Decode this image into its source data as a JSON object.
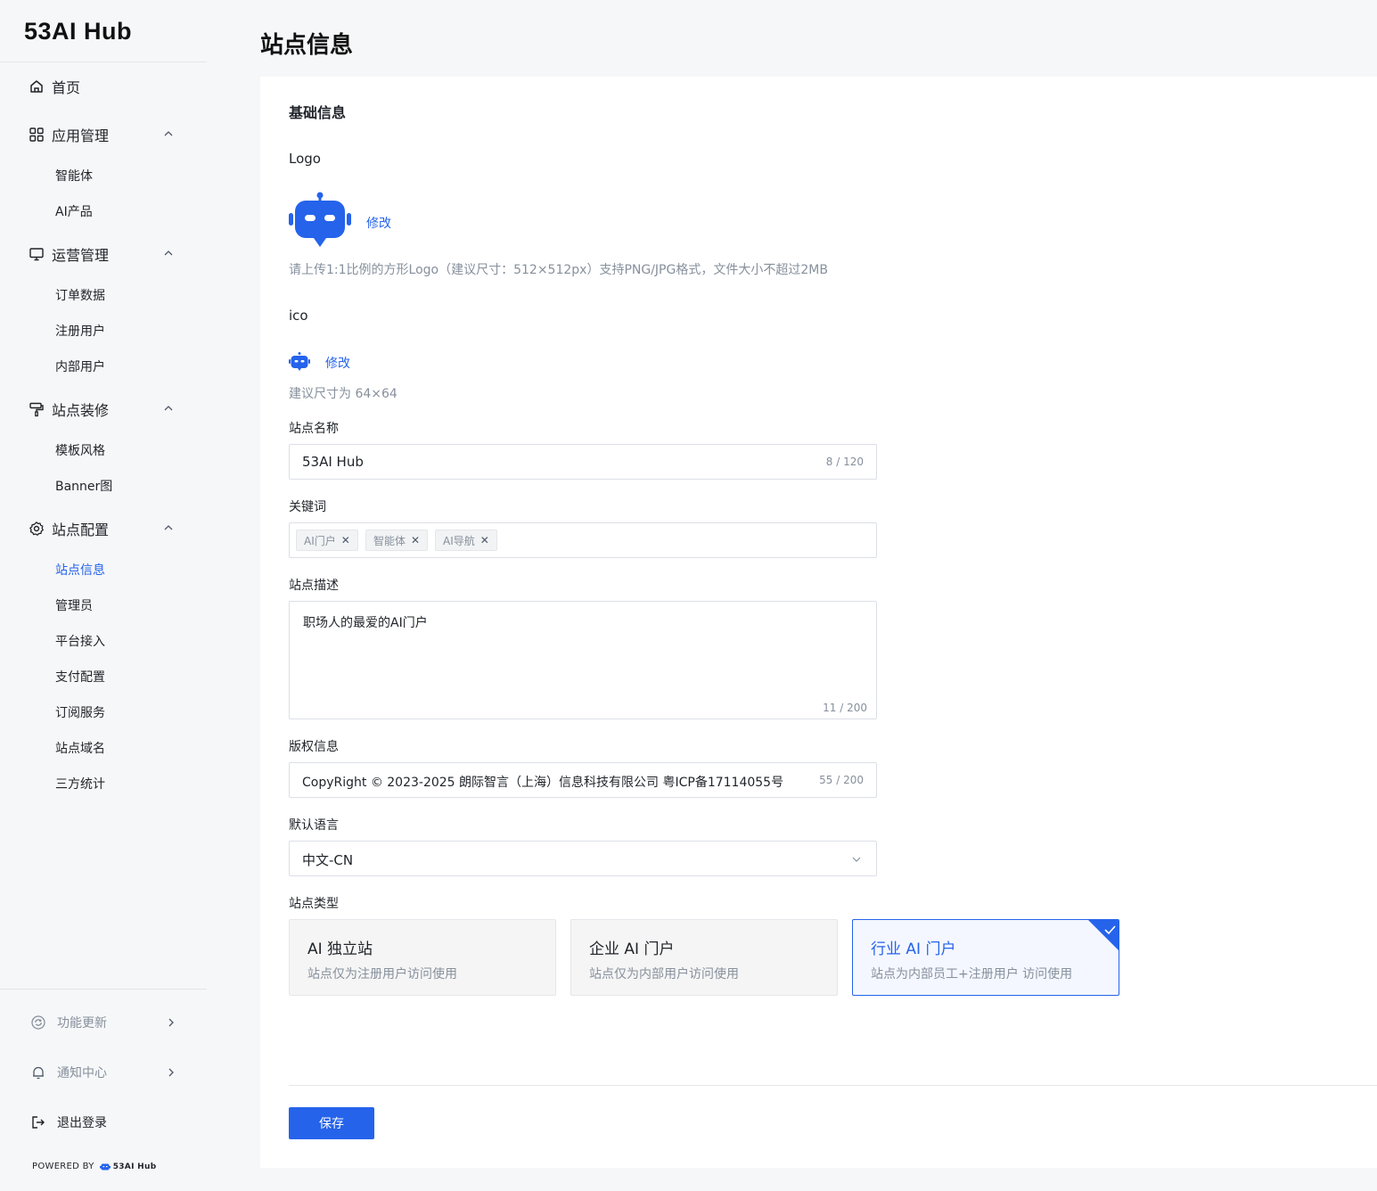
{
  "brand": "53AI Hub",
  "sidebar": {
    "home": "首页",
    "groups": [
      {
        "label": "应用管理",
        "items": [
          "智能体",
          "AI产品"
        ]
      },
      {
        "label": "运营管理",
        "items": [
          "订单数据",
          "注册用户",
          "内部用户"
        ]
      },
      {
        "label": "站点装修",
        "items": [
          "模板风格",
          "Banner图"
        ]
      },
      {
        "label": "站点配置",
        "items": [
          "站点信息",
          "管理员",
          "平台接入",
          "支付配置",
          "订阅服务",
          "站点域名",
          "三方统计"
        ]
      }
    ],
    "active_item": "站点信息",
    "footer": {
      "updates": "功能更新",
      "notifications": "通知中心",
      "logout": "退出登录",
      "powered_by": "POWERED BY",
      "powered_brand": "53AI Hub"
    }
  },
  "page": {
    "title": "站点信息",
    "section_title": "基础信息",
    "logo": {
      "label": "Logo",
      "edit": "修改",
      "hint": "请上传1:1比例的方形Logo（建议尺寸：512×512px）支持PNG/JPG格式，文件大小不超过2MB"
    },
    "ico": {
      "label": "ico",
      "edit": "修改",
      "hint": "建议尺寸为 64×64"
    },
    "site_name": {
      "label": "站点名称",
      "value": "53AI Hub",
      "count": "8 / 120"
    },
    "keywords": {
      "label": "关键词",
      "tags": [
        "AI门户",
        "智能体",
        "AI导航"
      ]
    },
    "description": {
      "label": "站点描述",
      "value": "职场人的最爱的AI门户",
      "count": "11 / 200"
    },
    "copyright": {
      "label": "版权信息",
      "value": "CopyRight © 2023-2025  朗际智言（上海）信息科技有限公司  粤ICP备17114055号",
      "count": "55 / 200"
    },
    "language": {
      "label": "默认语言",
      "value": "中文-CN"
    },
    "site_type": {
      "label": "站点类型",
      "options": [
        {
          "title": "AI 独立站",
          "desc": "站点仅为注册用户访问使用"
        },
        {
          "title": "企业 AI 门户",
          "desc": "站点仅为内部用户访问使用"
        },
        {
          "title": "行业 AI 门户",
          "desc": "站点为内部员工+注册用户 访问使用"
        }
      ],
      "selected": "行业 AI 门户"
    },
    "save": "保存"
  },
  "colors": {
    "accent": "#2563eb",
    "robot": "#2563eb"
  }
}
